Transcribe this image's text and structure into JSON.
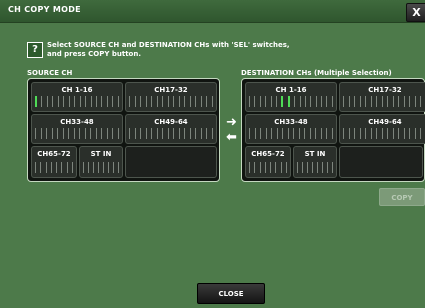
{
  "window": {
    "title": "CH COPY MODE",
    "close_glyph": "X"
  },
  "help_icon": "?",
  "instructions": {
    "line1": "Select SOURCE CH and DESTINATION CHs with 'SEL' switches,",
    "line2": "and press COPY button."
  },
  "source": {
    "label": "SOURCE CH",
    "blocks": [
      "CH 1-16",
      "CH17-32",
      "CH33-48",
      "CH49-64",
      "CH65-72",
      "ST IN"
    ]
  },
  "destination": {
    "label": "DESTINATION CHs (Multiple Selection)",
    "blocks": [
      "CH 1-16",
      "CH17-32",
      "CH33-48",
      "CH49-64",
      "CH65-72",
      "ST IN"
    ]
  },
  "arrows": {
    "right": "➜",
    "left": "⬅"
  },
  "buttons": {
    "copy": "COPY",
    "close": "CLOSE"
  },
  "colors": {
    "background": "#4d7a4a",
    "selected_channel": "#4fdc57"
  }
}
